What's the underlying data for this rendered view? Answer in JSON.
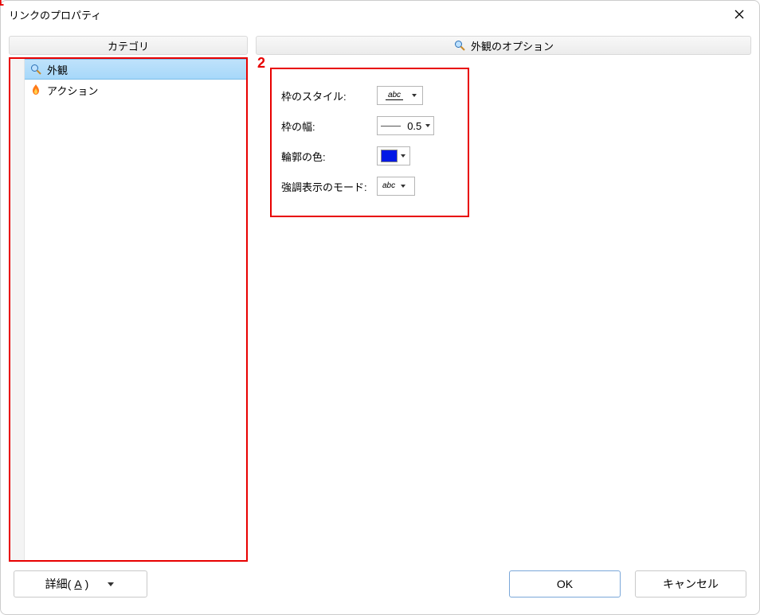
{
  "title": "リンクのプロパティ",
  "annotations": {
    "one": "1",
    "two": "2"
  },
  "left": {
    "header": "カテゴリ",
    "items": [
      {
        "label": "外観",
        "selected": true,
        "icon": "magnifier"
      },
      {
        "label": "アクション",
        "selected": false,
        "icon": "flame"
      }
    ]
  },
  "right": {
    "header": "外観のオプション",
    "options": {
      "border_style_label": "枠のスタイル:",
      "border_style_sample": "abc",
      "border_width_label": "枠の幅:",
      "border_width_value": "0.5",
      "outline_color_label": "輪郭の色:",
      "outline_color_value": "#0018e5",
      "highlight_mode_label": "強調表示のモード:",
      "highlight_mode_sample": "abc"
    }
  },
  "footer": {
    "detail_label_pre": "詳細(",
    "detail_mnemonic": "A",
    "detail_label_post": ")",
    "ok_label": "OK",
    "cancel_label": "キャンセル"
  }
}
